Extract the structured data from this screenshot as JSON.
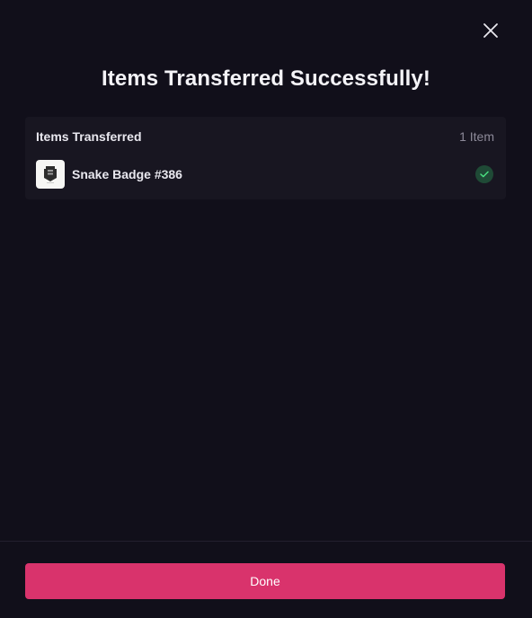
{
  "modal": {
    "title": "Items Transferred Successfully!",
    "close_icon": "close-icon"
  },
  "transferred": {
    "header_title": "Items Transferred",
    "count_label": "1 Item",
    "items": [
      {
        "name": "Snake Badge #386",
        "thumbnail_icon": "badge-thumbnail",
        "status_icon": "check-icon"
      }
    ]
  },
  "footer": {
    "done_label": "Done"
  },
  "colors": {
    "background": "#110f1a",
    "card": "#181621",
    "accent": "#d9336c",
    "success_badge": "#1f4a36",
    "success_check": "#4ade80",
    "muted_text": "#8d8a99"
  }
}
